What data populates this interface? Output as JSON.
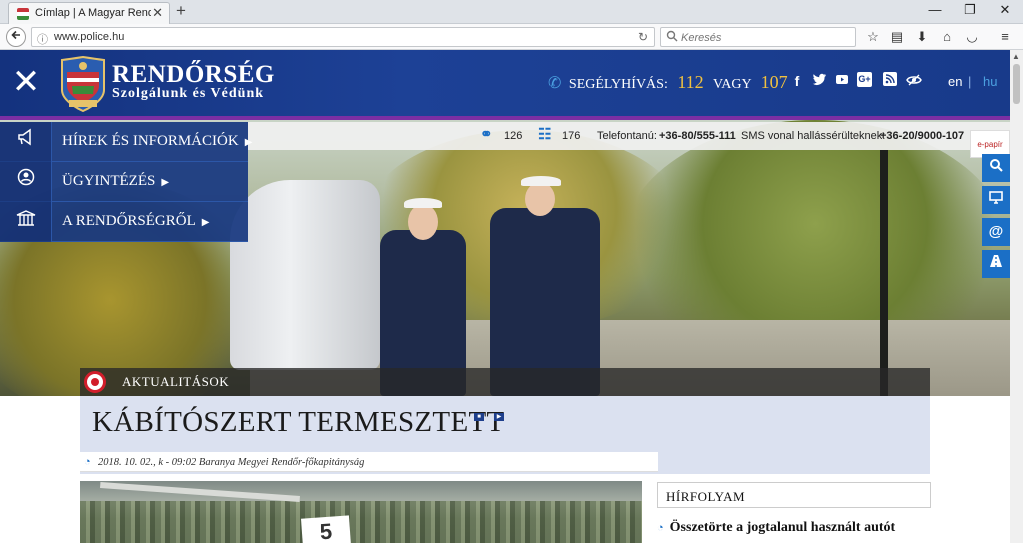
{
  "browser": {
    "tab_title": "Címlap | A Magyar Rendőr...",
    "tab_close": "✕",
    "new_tab": "+",
    "url": "www.police.hu",
    "search_placeholder": "Keresés",
    "window_controls": [
      "—",
      "❐",
      "✕"
    ],
    "toolbar_icons": [
      "star-icon",
      "reading-list-icon",
      "download-icon",
      "home-icon",
      "pocket-icon",
      "menu-icon"
    ]
  },
  "header": {
    "menu_close": "✕",
    "brand_title": "RENDŐRSÉG",
    "brand_subtitle": "Szolgálunk és Védünk",
    "logo_top": "RENDŐRSÉG",
    "logo_bottom": "POLICE",
    "emergency_label": "SEGÉLYHÍVÁS:",
    "emergency_num1": "112",
    "emergency_or": "VAGY",
    "emergency_num2": "107",
    "social": [
      "f",
      "t",
      "▶",
      "G+",
      "rss",
      "◉"
    ],
    "lang_en": "en",
    "lang_sep": "|",
    "lang_hu": "hu"
  },
  "strip": {
    "count1": "126",
    "count2": "176",
    "phone_label": "Telefontanú:",
    "phone_value": "+36-80/555-111",
    "sms_label": "SMS vonal hallássérülteknek:",
    "sms_value": "+36-20/9000-107",
    "epapir": "e-papír"
  },
  "sidenav": [
    {
      "label": "HÍREK ÉS INFORMÁCIÓK",
      "icon": "megaphone-icon"
    },
    {
      "label": "ÜGYINTÉZÉS",
      "icon": "user-icon"
    },
    {
      "label": "A RENDŐRSÉGRŐL",
      "icon": "building-icon"
    }
  ],
  "side_buttons": [
    "search-icon",
    "monitor-icon",
    "at-icon",
    "road-icon"
  ],
  "article": {
    "category": "AKTUALITÁSOK",
    "title": "KÁBÍTÓSZERT TERMESZTETT",
    "meta": "2018. 10. 02., k - 09:02 Baranya Megyei Rendőr-főkapitányság",
    "photo_card": "5"
  },
  "feed": {
    "heading": "HÍRFOLYAM",
    "first_item": "Összetörte a jogtalanul használt autót"
  },
  "colors": {
    "header_blue": "#1a3b8c",
    "accent_blue": "#1b6fc6",
    "emergency_gold": "#f0c140",
    "title_bg": "#dbe1f0",
    "target_red": "#d21e2b"
  }
}
